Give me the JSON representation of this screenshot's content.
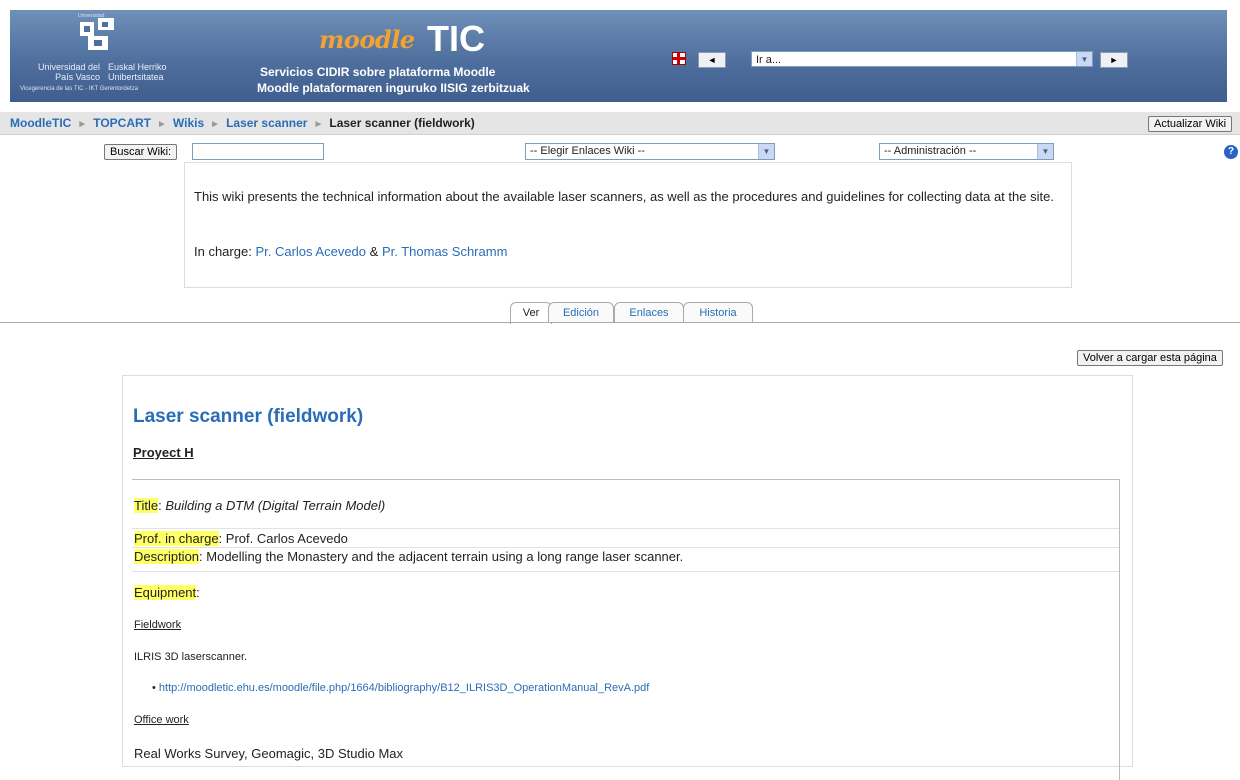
{
  "header": {
    "university_top": "Universidad",
    "university_es": "Universidad del País Vasco",
    "university_eu": "Euskal Herriko Unibertsitatea",
    "vicerrectorado": "Vicegerencia de las TIC - IKT Gerentordetza",
    "moodle_word": "moodle",
    "tic_word": "TIC",
    "subtitle_1": "Servicios CIDIR sobre plataforma Moodle",
    "subtitle_2": "Moodle plataformaren inguruko IISIG zerbitzuak",
    "goto_placeholder": "Ir a...",
    "prev_arrow": "◄",
    "next_arrow": "►"
  },
  "breadcrumb": {
    "items": [
      "MoodleTIC",
      "TOPCART",
      "Wikis",
      "Laser scanner"
    ],
    "current": "Laser scanner (fieldwork)",
    "separator": "►"
  },
  "toolbar": {
    "update_wiki": "Actualizar Wiki",
    "search_wiki": "Buscar Wiki:",
    "search_value": "",
    "links_select": "-- Elegir Enlaces Wiki --",
    "admin_select": "-- Administración --",
    "help": "?"
  },
  "summary": {
    "text": "This wiki presents the technical information about the available laser scanners, as well as the procedures and guidelines for collecting data at the site.",
    "incharge_label": "In charge:",
    "person_1": "Pr. Carlos Acevedo",
    "amp": "&",
    "person_2": "Pr. Thomas Schramm"
  },
  "tabs": [
    "Ver",
    "Edición",
    "Enlaces",
    "Historia"
  ],
  "reload_button": "Volver a cargar esta página",
  "content": {
    "heading": "Laser scanner (fieldwork)",
    "project": "Proyect H",
    "title_label": "Title",
    "title_value": "Building a DTM (Digital Terrain Model)",
    "prof_label": "Prof. in charge",
    "prof_value": "Prof. Carlos Acevedo",
    "desc_label": "Description",
    "desc_value": "Modelling the Monastery and the adjacent terrain using a long range laser scanner.",
    "equipment_label": "Equipment",
    "fieldwork": "Fieldwork",
    "ilris": "ILRIS 3D laserscanner.",
    "manual_link": "http://moodletic.ehu.es/moodle/file.php/1664/bibliography/B12_ILRIS3D_OperationManual_RevA.pdf",
    "office_work": "Office work",
    "software": "Real Works Survey, Geomagic, 3D Studio Max"
  },
  "colors": {
    "header_blue": "#4f6f9e",
    "link": "#2a6db7",
    "moodle_orange": "#f3a230",
    "highlight": "#ffff66"
  }
}
